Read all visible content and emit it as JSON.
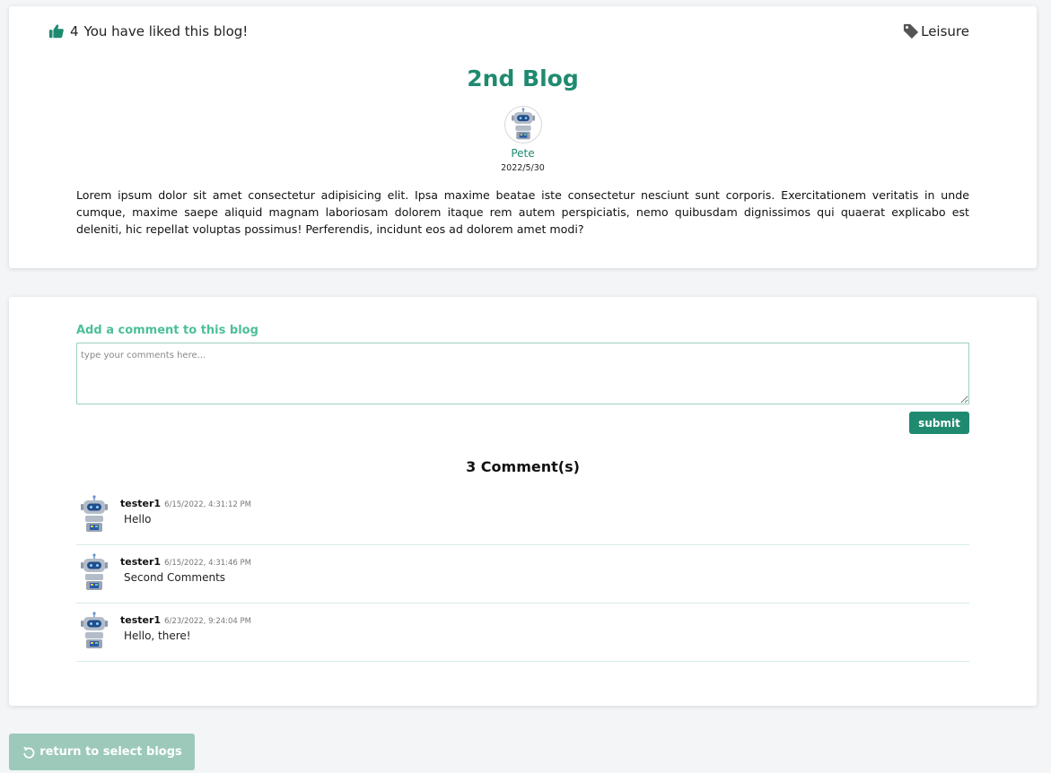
{
  "blog": {
    "like_count": "4",
    "like_text": "You have liked this blog!",
    "tag": "Leisure",
    "title": "2nd Blog",
    "author": "Pete",
    "date": "2022/5/30",
    "body": "Lorem ipsum dolor sit amet consectetur adipisicing elit. Ipsa maxime beatae iste consectetur nesciunt sunt corporis. Exercitationem veritatis in unde cumque, maxime saepe aliquid magnam laboriosam dolorem itaque rem autem perspiciatis, nemo quibusdam dignissimos qui quaerat explicabo est deleniti, hic repellat voluptas possimus! Perferendis, incidunt eos ad dolorem amet modi?"
  },
  "comment_form": {
    "label": "Add a comment to this blog",
    "placeholder": "type your comments here...",
    "value": "",
    "submit_label": "submit"
  },
  "comments": {
    "count_label": "3 Comment(s)",
    "items": [
      {
        "user": "tester1",
        "time": "6/15/2022, 4:31:12 PM",
        "text": "Hello"
      },
      {
        "user": "tester1",
        "time": "6/15/2022, 4:31:46 PM",
        "text": "Second Comments"
      },
      {
        "user": "tester1",
        "time": "6/23/2022, 9:24:04 PM",
        "text": "Hello, there!"
      }
    ]
  },
  "footer": {
    "return_label": "return to select blogs"
  },
  "icons": {
    "like": "thumbs-up-icon",
    "tag": "tag-icon",
    "avatar": "robot-avatar",
    "return": "undo-icon"
  },
  "colors": {
    "accent": "#1f8a70",
    "label_green": "#4cbf98",
    "return_button": "#9cc9b9",
    "background": "#f4f5f7"
  }
}
